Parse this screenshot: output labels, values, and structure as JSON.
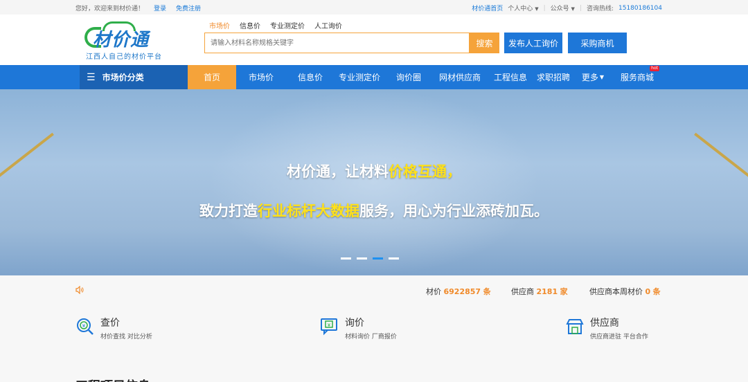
{
  "topbar": {
    "greeting": "您好，欢迎来到材价通！",
    "login": "登录",
    "register": "免费注册",
    "home_link": "材价通首页",
    "user_center": "个人中心",
    "official_account": "公众号",
    "hotline_label": "咨询热线:",
    "hotline": "15180186104"
  },
  "logo": {
    "brand": "材价通",
    "slogan": "江西人自己的材价平台"
  },
  "search": {
    "tabs": [
      "市场价",
      "信息价",
      "专业测定价",
      "人工询价"
    ],
    "active_tab": 0,
    "placeholder": "请输入材料名称规格关键字",
    "button": "搜索"
  },
  "header_buttons": {
    "publish": "发布人工询价",
    "purchase": "采购商机"
  },
  "nav": {
    "category": "市场价分类",
    "items": [
      "首页",
      "市场价",
      "信息价",
      "专业测定价",
      "询价圈",
      "网材供应商",
      "工程信息",
      "求职招聘",
      "更多",
      "服务商城"
    ],
    "hot_badge": "hot"
  },
  "banner": {
    "line1_pre": "材价通，让材料",
    "line1_hl": "价格互通",
    "line1_post": "，",
    "line2_pre": "致力打造",
    "line2_hl": "行业标杆大数据",
    "line2_post": "服务，用心为行业添砖加瓦。",
    "slides": 4,
    "active_slide": 2
  },
  "stats": [
    {
      "label": "材价",
      "value": "6922857",
      "unit": "条"
    },
    {
      "label": "供应商",
      "value": "2181",
      "unit": "家"
    },
    {
      "label": "供应商本周材价",
      "value": "0",
      "unit": "条"
    }
  ],
  "features": [
    {
      "title": "查价",
      "sub": "材价查找 对比分析",
      "icon": "price-search-icon"
    },
    {
      "title": "询价",
      "sub": "材料询价 厂商报价",
      "icon": "inquiry-icon"
    },
    {
      "title": "供应商",
      "sub": "供应商进驻 平台合作",
      "icon": "store-icon"
    }
  ],
  "section_title": "工程项目信息",
  "colors": {
    "primary": "#1e77d8",
    "accent": "#f5a33a",
    "highlight": "#ffe11a"
  }
}
